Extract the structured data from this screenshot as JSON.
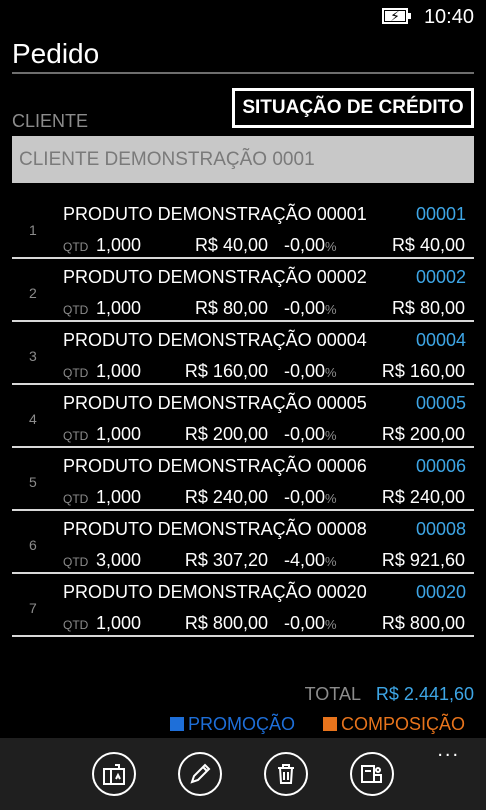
{
  "status": {
    "time": "10:40",
    "battery_icon": "battery-charging-icon"
  },
  "page": {
    "title": "Pedido"
  },
  "client": {
    "label": "CLIENTE",
    "value": "CLIENTE DEMONSTRAÇÃO 0001",
    "credit_button": "SITUAÇÃO DE CRÉDITO"
  },
  "items": [
    {
      "idx": "1",
      "name": "PRODUTO DEMONSTRAÇÃO 00001",
      "code": "00001",
      "qtd_label": "QTD",
      "qtd": "1,000",
      "price": "R$ 40,00",
      "discount": "-0,00",
      "pct": "%",
      "total": "R$ 40,00"
    },
    {
      "idx": "2",
      "name": "PRODUTO DEMONSTRAÇÃO 00002",
      "code": "00002",
      "qtd_label": "QTD",
      "qtd": "1,000",
      "price": "R$ 80,00",
      "discount": "-0,00",
      "pct": "%",
      "total": "R$ 80,00"
    },
    {
      "idx": "3",
      "name": "PRODUTO DEMONSTRAÇÃO 00004",
      "code": "00004",
      "qtd_label": "QTD",
      "qtd": "1,000",
      "price": "R$ 160,00",
      "discount": "-0,00",
      "pct": "%",
      "total": "R$ 160,00"
    },
    {
      "idx": "4",
      "name": "PRODUTO DEMONSTRAÇÃO 00005",
      "code": "00005",
      "qtd_label": "QTD",
      "qtd": "1,000",
      "price": "R$ 200,00",
      "discount": "-0,00",
      "pct": "%",
      "total": "R$ 200,00"
    },
    {
      "idx": "5",
      "name": "PRODUTO DEMONSTRAÇÃO 00006",
      "code": "00006",
      "qtd_label": "QTD",
      "qtd": "1,000",
      "price": "R$ 240,00",
      "discount": "-0,00",
      "pct": "%",
      "total": "R$ 240,00"
    },
    {
      "idx": "6",
      "name": "PRODUTO DEMONSTRAÇÃO 00008",
      "code": "00008",
      "qtd_label": "QTD",
      "qtd": "3,000",
      "price": "R$ 307,20",
      "discount": "-4,00",
      "pct": "%",
      "total": "R$ 921,60"
    },
    {
      "idx": "7",
      "name": "PRODUTO DEMONSTRAÇÃO 00020",
      "code": "00020",
      "qtd_label": "QTD",
      "qtd": "1,000",
      "price": "R$ 800,00",
      "discount": "-0,00",
      "pct": "%",
      "total": "R$ 800,00"
    }
  ],
  "summary": {
    "total_label": "TOTAL",
    "total_value": "R$ 2.441,60"
  },
  "legend": {
    "promo": {
      "label": "PROMOÇÃO",
      "color": "#1e6fd9"
    },
    "composition": {
      "label": "COMPOSIÇÃO",
      "color": "#e8741c"
    }
  },
  "appbar": {
    "buttons": [
      {
        "icon": "products-box-icon"
      },
      {
        "icon": "pencil-edit-icon"
      },
      {
        "icon": "trash-delete-icon"
      },
      {
        "icon": "payment-cart-icon"
      }
    ],
    "more": "..."
  },
  "colors": {
    "accent": "#3ea6e6",
    "background": "#000000",
    "field": "#c8c8c8"
  }
}
